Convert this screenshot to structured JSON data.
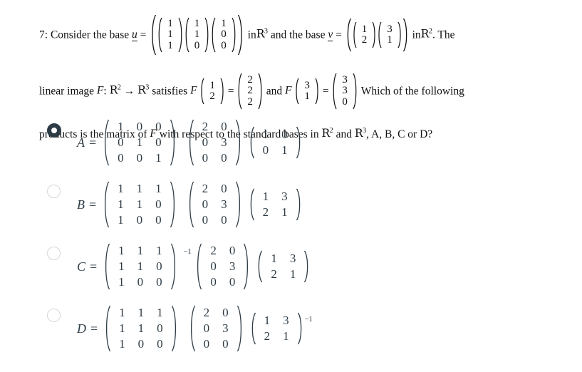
{
  "question": {
    "number": "7:",
    "line1_pre": "Consider the base",
    "var_u": "u",
    "equals": "=",
    "u_vectors": [
      [
        "1",
        "1",
        "1"
      ],
      [
        "1",
        "1",
        "0"
      ],
      [
        "1",
        "0",
        "0"
      ]
    ],
    "line1_mid": "in",
    "space_R3": "R",
    "exp_3": "3",
    "line1_mid2": "and the base",
    "var_v": "v",
    "v_vectors": [
      [
        "1",
        "2"
      ],
      [
        "3",
        "1"
      ]
    ],
    "line1_post": "in",
    "space_R2": "R",
    "exp_2": "2",
    "line1_end": ". The",
    "line2_pre": "linear image",
    "var_F": "F",
    "colon": ":",
    "arrow": "→",
    "satisfies": "satisfies",
    "F1_arg": [
      "1",
      "2"
    ],
    "F1_val": [
      "2",
      "2",
      "2"
    ],
    "and": "and",
    "F2_arg": [
      "3",
      "1"
    ],
    "F2_val": [
      "3",
      "3",
      "0"
    ],
    "line2_end": "Which of the following",
    "line3": "products is the matrix of F with respect to the standard bases in R2 and R3, A, B, C or D?",
    "line3_a": "products is the matrix of",
    "line3_b": "with respect to the standard bases in",
    "line3_c": "and",
    "line3_d": ", A, B, C or D?"
  },
  "options": [
    {
      "id": "A",
      "label": "A",
      "selected": true,
      "radio_name": "radio-option-a",
      "m3": [
        [
          "1",
          "0",
          "0"
        ],
        [
          "0",
          "1",
          "0"
        ],
        [
          "0",
          "0",
          "1"
        ]
      ],
      "m3_exp": "",
      "m32": [
        [
          "2",
          "0"
        ],
        [
          "0",
          "3"
        ],
        [
          "0",
          "0"
        ]
      ],
      "m2": [
        [
          "1",
          "0"
        ],
        [
          "0",
          "1"
        ]
      ],
      "m2_exp": ""
    },
    {
      "id": "B",
      "label": "B",
      "selected": false,
      "radio_name": "radio-option-b",
      "m3": [
        [
          "1",
          "1",
          "1"
        ],
        [
          "1",
          "1",
          "0"
        ],
        [
          "1",
          "0",
          "0"
        ]
      ],
      "m3_exp": "",
      "m32": [
        [
          "2",
          "0"
        ],
        [
          "0",
          "3"
        ],
        [
          "0",
          "0"
        ]
      ],
      "m2": [
        [
          "1",
          "3"
        ],
        [
          "2",
          "1"
        ]
      ],
      "m2_exp": ""
    },
    {
      "id": "C",
      "label": "C",
      "selected": false,
      "radio_name": "radio-option-c",
      "m3": [
        [
          "1",
          "1",
          "1"
        ],
        [
          "1",
          "1",
          "0"
        ],
        [
          "1",
          "0",
          "0"
        ]
      ],
      "m3_exp": "−1",
      "m32": [
        [
          "2",
          "0"
        ],
        [
          "0",
          "3"
        ],
        [
          "0",
          "0"
        ]
      ],
      "m2": [
        [
          "1",
          "3"
        ],
        [
          "2",
          "1"
        ]
      ],
      "m2_exp": ""
    },
    {
      "id": "D",
      "label": "D",
      "selected": false,
      "radio_name": "radio-option-d",
      "m3": [
        [
          "1",
          "1",
          "1"
        ],
        [
          "1",
          "1",
          "0"
        ],
        [
          "1",
          "0",
          "0"
        ]
      ],
      "m3_exp": "",
      "m32": [
        [
          "2",
          "0"
        ],
        [
          "0",
          "3"
        ],
        [
          "0",
          "0"
        ]
      ],
      "m2": [
        [
          "1",
          "3"
        ],
        [
          "2",
          "1"
        ]
      ],
      "m2_exp": "−1"
    }
  ],
  "colors": {
    "background": "#ffffff",
    "stem_text": "#111111",
    "option_text": "#2d3b45",
    "radio_selected": "#2d3b45",
    "radio_unselected_border": "#d3d8dd"
  }
}
